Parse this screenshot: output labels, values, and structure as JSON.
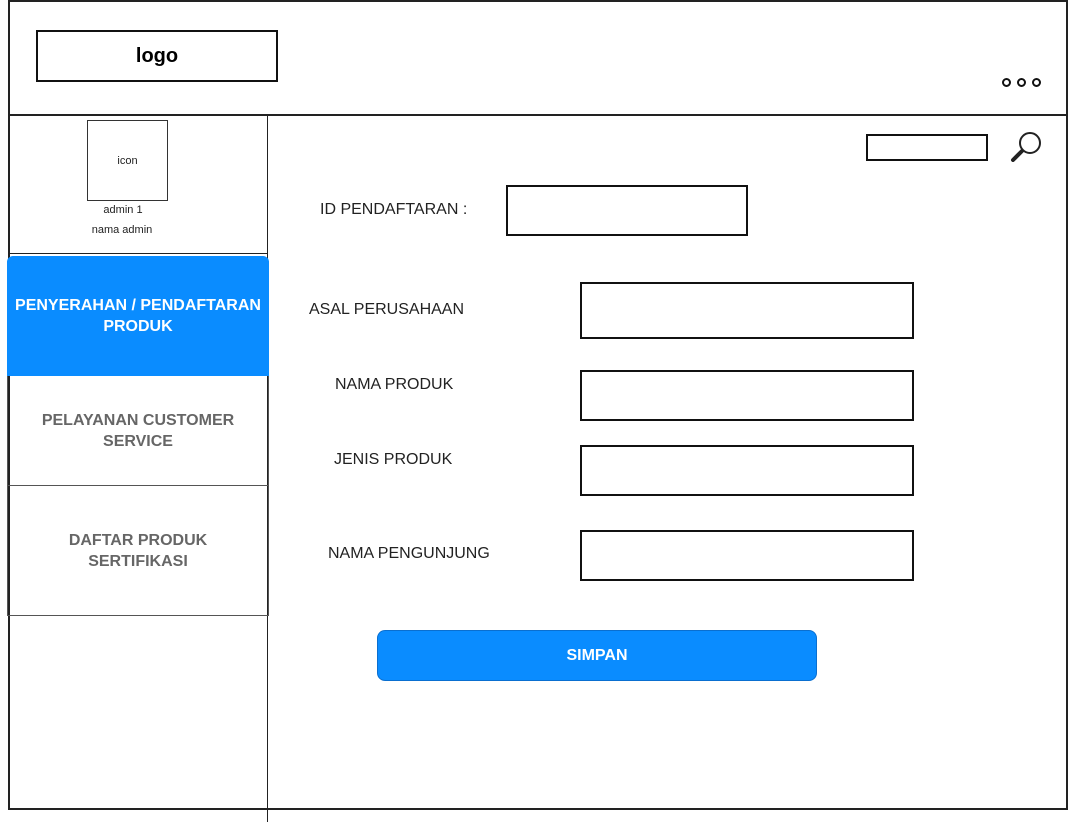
{
  "header": {
    "logo": "logo",
    "more_icon": "more-horizontal-icon"
  },
  "profile": {
    "icon_label": "icon",
    "admin_id": "admin 1",
    "admin_name": "nama admin"
  },
  "sidebar": {
    "items": [
      {
        "label": "PENYERAHAN / PENDAFTARAN\nPRODUK",
        "active": true
      },
      {
        "label": "PELAYANAN CUSTOMER\nSERVICE",
        "active": false
      },
      {
        "label": "DAFTAR PRODUK\nSERTIFIKASI",
        "active": false
      }
    ]
  },
  "search": {
    "value": "",
    "icon": "search-icon"
  },
  "form": {
    "id_label": "ID PENDAFTARAN :",
    "id_value": "",
    "asal_label": "ASAL PERUSAHAAN",
    "asal_value": "",
    "nama_produk_label": "NAMA PRODUK",
    "nama_produk_value": "",
    "jenis_label": "JENIS PRODUK",
    "jenis_value": "",
    "pengunjung_label": "NAMA PENGUNJUNG",
    "pengunjung_value": "",
    "submit_label": "SIMPAN"
  },
  "colors": {
    "accent": "#0a8cff",
    "nav_text_inactive": "#666666"
  }
}
